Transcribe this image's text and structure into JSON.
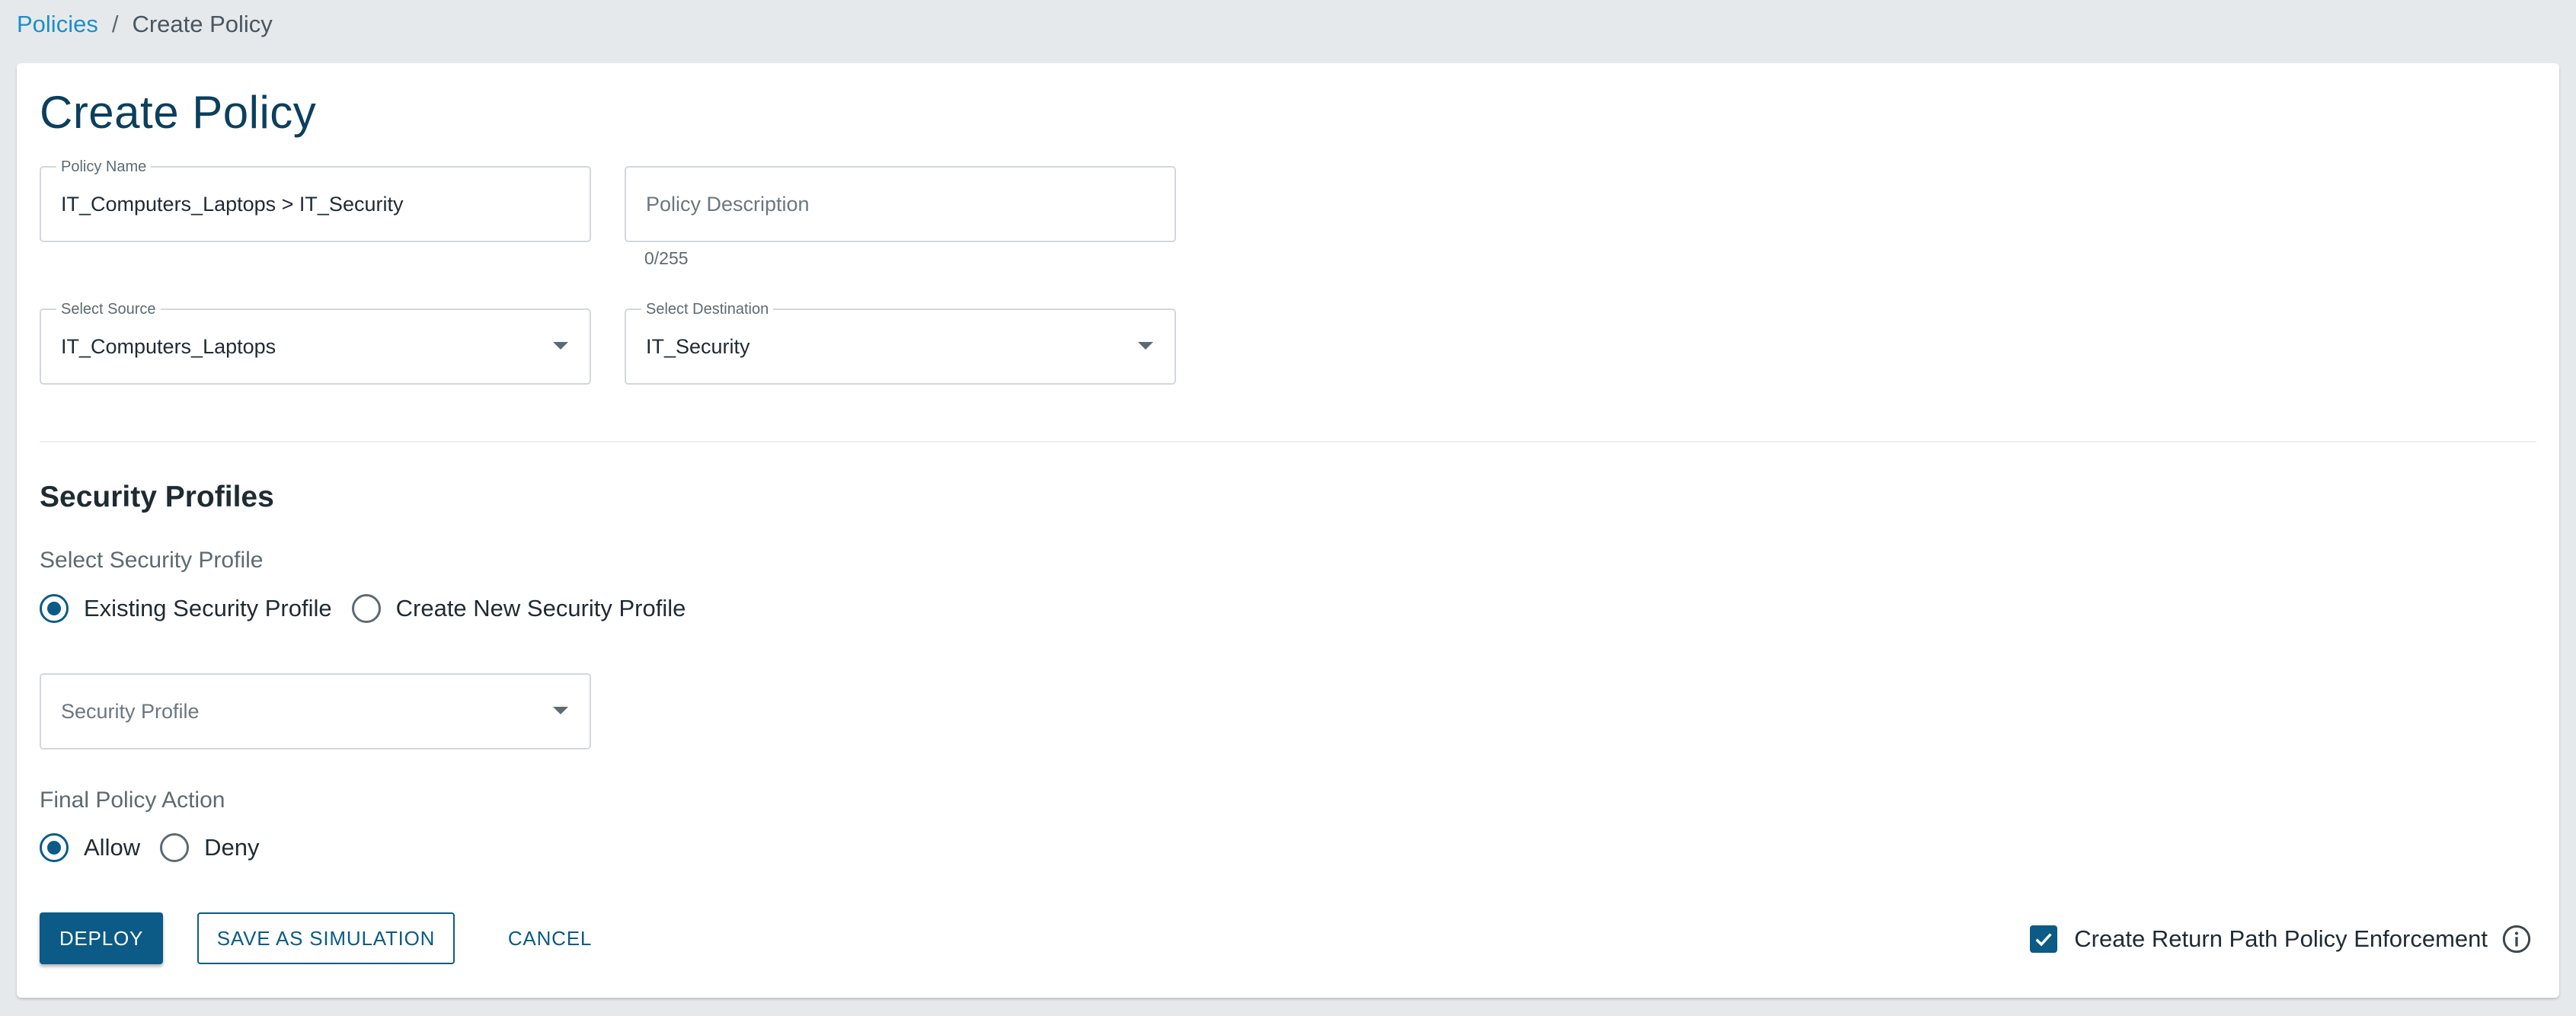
{
  "breadcrumb": {
    "parent": "Policies",
    "separator": "/",
    "current": "Create Policy"
  },
  "page": {
    "title": "Create Policy"
  },
  "form": {
    "policy_name": {
      "label": "Policy Name",
      "value": "IT_Computers_Laptops > IT_Security"
    },
    "policy_description": {
      "placeholder": "Policy Description",
      "counter": "0/255"
    },
    "source": {
      "label": "Select Source",
      "value": "IT_Computers_Laptops"
    },
    "destination": {
      "label": "Select Destination",
      "value": "IT_Security"
    }
  },
  "security_profiles": {
    "title": "Security Profiles",
    "select_label": "Select Security Profile",
    "options": [
      {
        "label": "Existing Security Profile",
        "checked": true
      },
      {
        "label": "Create New Security Profile",
        "checked": false
      }
    ],
    "profile_dropdown_placeholder": "Security Profile"
  },
  "final_action": {
    "label": "Final Policy Action",
    "options": [
      {
        "label": "Allow",
        "checked": true
      },
      {
        "label": "Deny",
        "checked": false
      }
    ]
  },
  "actions": {
    "deploy": "DEPLOY",
    "save_simulation": "SAVE AS SIMULATION",
    "cancel": "CANCEL"
  },
  "return_path": {
    "label": "Create Return Path Policy Enforcement",
    "checked": true
  },
  "colors": {
    "primary": "#0b5b86",
    "link": "#1f8ec8",
    "title": "#0b3f5e",
    "background": "#e6e9ec"
  }
}
